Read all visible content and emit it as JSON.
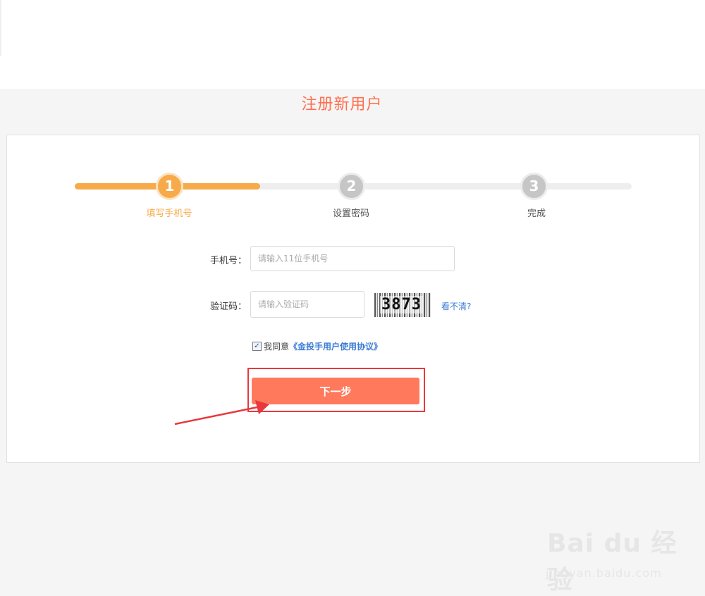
{
  "page_title": "注册新用户",
  "steps": [
    {
      "number": "1",
      "label": "填写手机号",
      "active": true
    },
    {
      "number": "2",
      "label": "设置密码",
      "active": false
    },
    {
      "number": "3",
      "label": "完成",
      "active": false
    }
  ],
  "progress_fraction": 0.333,
  "form": {
    "phone_label": "手机号：",
    "phone_placeholder": "请输入11位手机号",
    "code_label": "验证码：",
    "code_placeholder": "请输入验证码",
    "captcha_text": "3873",
    "refresh_link": "看不清?"
  },
  "agreement": {
    "checked": true,
    "prefix": "我同意",
    "link": "《金投手用户使用协议》"
  },
  "next_button": "下一步",
  "watermark": {
    "brand": "Bai du 经验",
    "url": "jingyan.baidu.com"
  },
  "colors": {
    "accent": "#f7aa4a",
    "button": "#ff7a5c",
    "title": "#ff6f4f",
    "link": "#3a7bd5",
    "highlight": "#e8383d"
  }
}
